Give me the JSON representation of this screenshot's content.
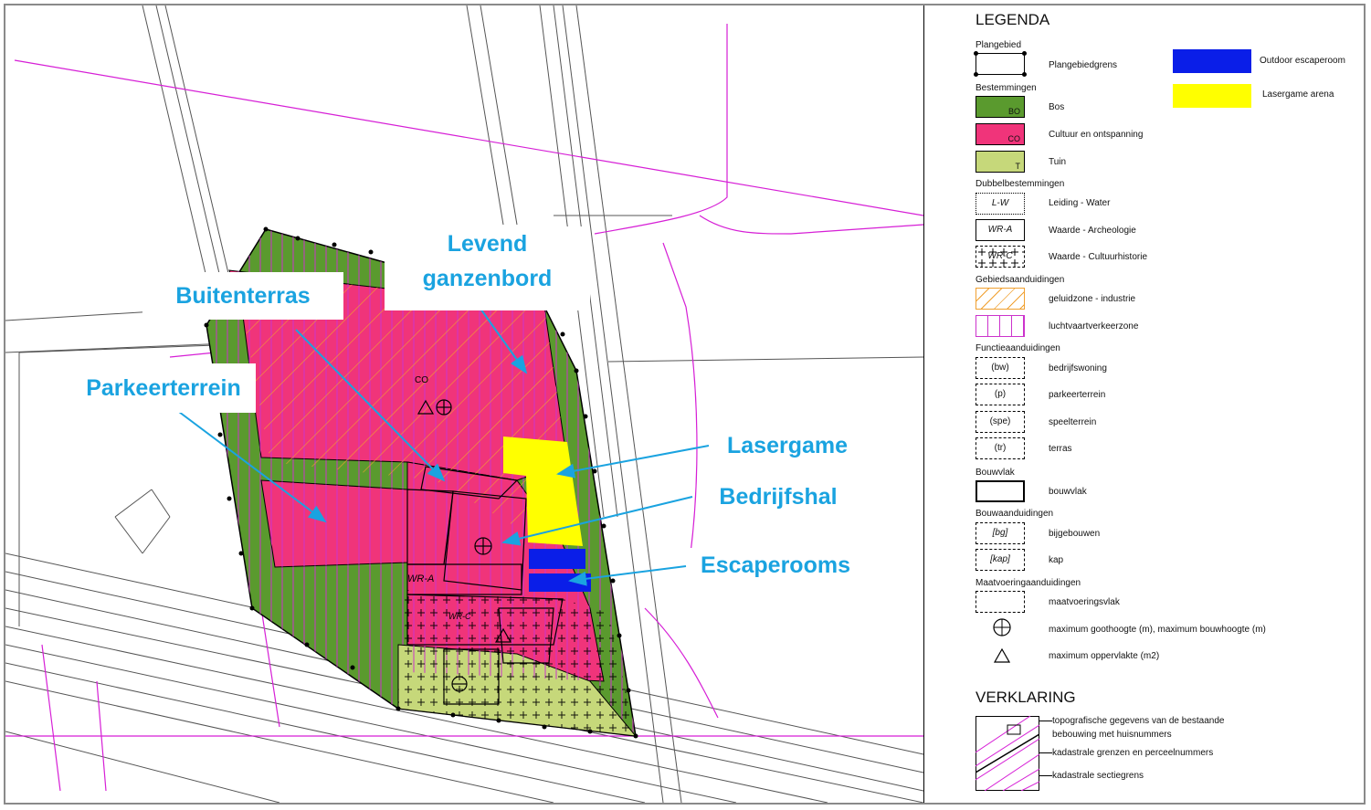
{
  "callouts": {
    "levend_line1": "Levend",
    "levend_line2": "ganzenbord",
    "buitenterras": "Buitenterras",
    "parkeerterrein": "Parkeerterrein",
    "lasergame": "Lasergame",
    "bedrijfshal": "Bedrijfshal",
    "escaperooms": "Escaperooms"
  },
  "map_labels": {
    "co": "CO",
    "wr_a": "WR-A",
    "wr_c": "WR-C"
  },
  "colors": {
    "bos": "#5a9a2e",
    "cultuur": "#f0347a",
    "tuin": "#c6d87a",
    "escape": "#0a1ee8",
    "lasergame": "#ffff00",
    "geluidzone": "#f0a030",
    "luchtvaart": "#cc33cc",
    "callout_text": "#1aa3e0"
  },
  "legend": {
    "title": "LEGENDA",
    "plangebied_head": "Plangebied",
    "plangebiedgrens": "Plangebiedgrens",
    "outdoor_escape": "Outdoor escaperoom",
    "lasergame_arena": "Lasergame arena",
    "bestemmingen_head": "Bestemmingen",
    "bos": "Bos",
    "bos_code": "BO",
    "cultuur": "Cultuur en ontspanning",
    "cultuur_code": "CO",
    "tuin": "Tuin",
    "tuin_code": "T",
    "dubbel_head": "Dubbelbestemmingen",
    "leiding_water": "Leiding - Water",
    "leiding_code": "L-W",
    "archeologie": "Waarde - Archeologie",
    "archeologie_code": "WR-A",
    "cultuurhistorie": "Waarde - Cultuurhistorie",
    "cultuurhistorie_code": "WR-C",
    "gebieds_head": "Gebiedsaanduidingen",
    "geluidzone": "geluidzone - industrie",
    "luchtvaart": "luchtvaartverkeerzone",
    "functie_head": "Functieaanduidingen",
    "bw_code": "(bw)",
    "bedrijfswoning": "bedrijfswoning",
    "p_code": "(p)",
    "parkeerterrein": "parkeerterrein",
    "spe_code": "(spe)",
    "speelterrein": "speelterrein",
    "tr_code": "(tr)",
    "terras": "terras",
    "bouwvlak_head": "Bouwvlak",
    "bouwvlak": "bouwvlak",
    "bouwaand_head": "Bouwaanduidingen",
    "bg_code": "[bg]",
    "bijgebouwen": "bijgebouwen",
    "kap_code": "[kap]",
    "kap": "kap",
    "maat_head": "Maatvoeringaanduidingen",
    "maatvoeringsvlak": "maatvoeringsvlak",
    "goothoogte": "maximum goothoogte (m), maximum bouwhoogte (m)",
    "oppervlakte": "maximum oppervlakte (m2)"
  },
  "verklaring": {
    "title": "VERKLARING",
    "topo_line1": "topografische gegevens van de bestaande",
    "topo_line2": "bebouwing met huisnummers",
    "kadastrale_grenzen": "kadastrale grenzen en perceelnummers",
    "sectiegrens": "kadastrale sectiegrens"
  }
}
